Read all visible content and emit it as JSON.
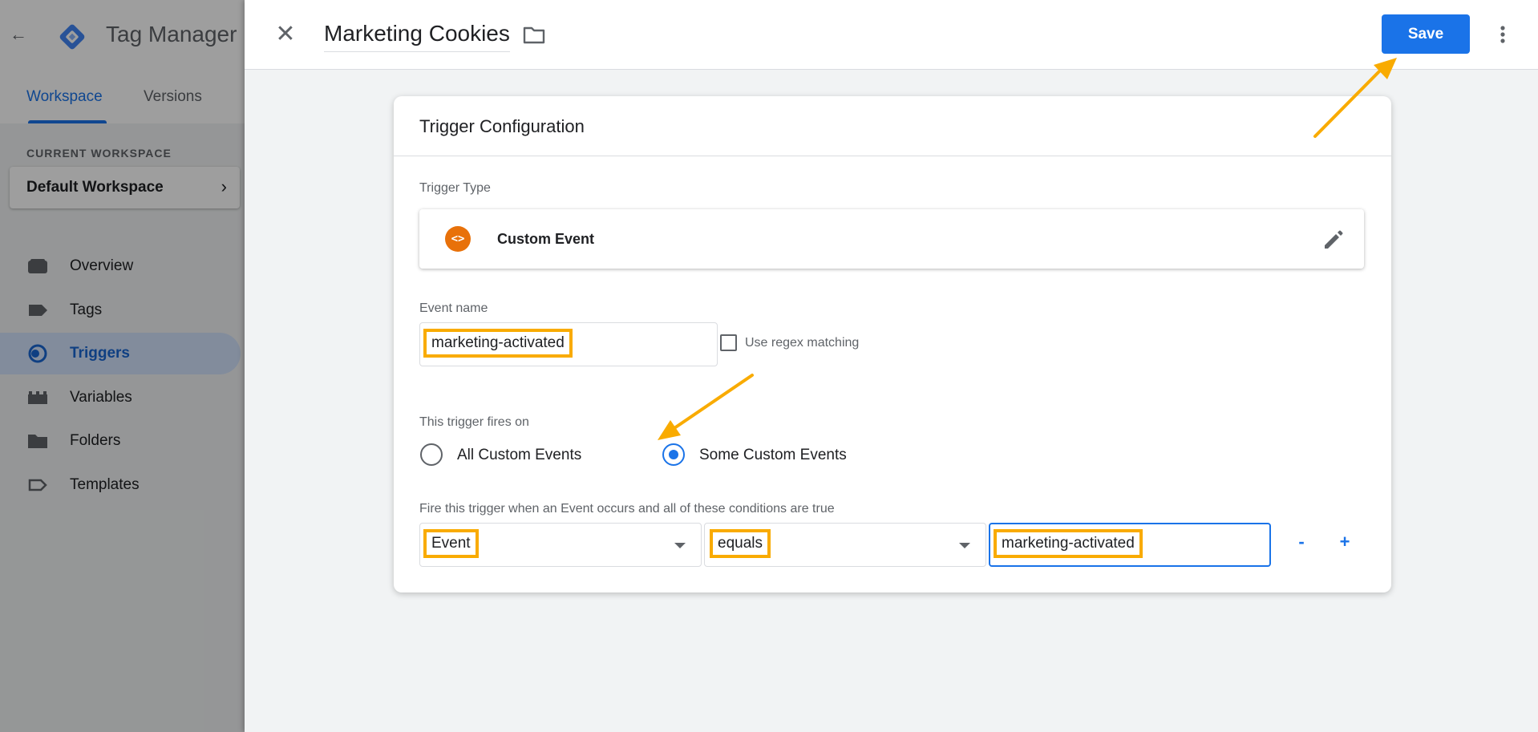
{
  "app": {
    "product_name": "Tag Manager",
    "tabs": [
      "Workspace",
      "Versions"
    ],
    "current_workspace_label": "CURRENT WORKSPACE",
    "workspace_name": "Default Workspace",
    "nav": [
      {
        "label": "Overview",
        "icon": "overview-icon"
      },
      {
        "label": "Tags",
        "icon": "tag-icon"
      },
      {
        "label": "Triggers",
        "icon": "trigger-icon"
      },
      {
        "label": "Variables",
        "icon": "variables-icon"
      },
      {
        "label": "Folders",
        "icon": "folder-icon"
      },
      {
        "label": "Templates",
        "icon": "template-icon"
      }
    ],
    "active_nav": "Triggers"
  },
  "editor": {
    "title": "Marketing Cookies",
    "save_label": "Save"
  },
  "trigger_config": {
    "title": "Trigger Configuration",
    "type_label": "Trigger Type",
    "type_name": "Custom Event",
    "type_icon_text": "<>",
    "event_name_label": "Event name",
    "event_name_value": "marketing-activated",
    "regex_label": "Use regex matching",
    "regex_checked": false,
    "fires_on_label": "This trigger fires on",
    "fires_on_options": [
      "All Custom Events",
      "Some Custom Events"
    ],
    "fires_on_selected": "Some Custom Events",
    "condition_label": "Fire this trigger when an Event occurs and all of these conditions are true",
    "condition": {
      "variable": "Event",
      "operator": "equals",
      "value": "marketing-activated"
    },
    "remove_label": "-",
    "add_label": "+"
  },
  "colors": {
    "accent": "#1a73e8",
    "highlight": "#f9ab00",
    "trigger_icon": "#e8710a"
  }
}
